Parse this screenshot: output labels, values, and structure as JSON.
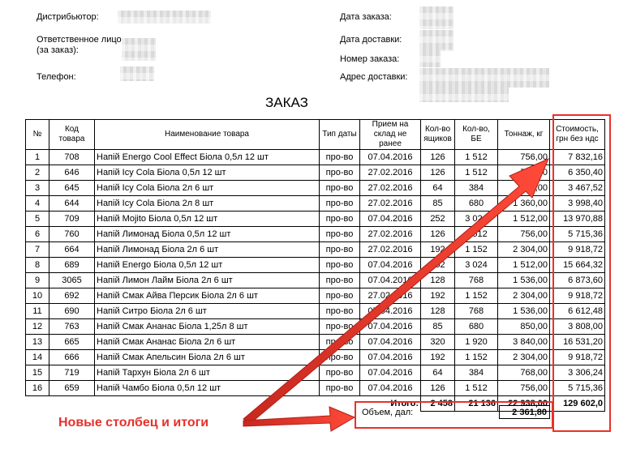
{
  "header": {
    "distributor_label": "Дистрибьютор:",
    "responsible_label": "Ответственное лицо\n(за заказ):",
    "phone_label": "Телефон:",
    "order_date_label": "Дата заказа:",
    "delivery_date_label": "Дата доставки:",
    "order_number_label": "Номер заказа:",
    "delivery_address_label": "Адрес доставки:"
  },
  "title": "ЗАКАЗ",
  "table": {
    "columns": [
      "№",
      "Код товара",
      "Наименование товара",
      "Тип даты",
      "Прием на склад не ранее",
      "Кол-во ящиков",
      "Кол-во, БЕ",
      "Тоннаж, кг",
      "Стоимость, грн без ндс"
    ],
    "rows": [
      [
        "1",
        "708",
        "Напій Energo Cool Effect Біола 0,5л 12 шт",
        "про-во",
        "07.04.2016",
        "126",
        "1 512",
        "756,00",
        "7 832,16"
      ],
      [
        "2",
        "646",
        "Напій Icy Cola Біола 0,5л 12 шт",
        "про-во",
        "27.02.2016",
        "126",
        "1 512",
        "756,00",
        "6 350,40"
      ],
      [
        "3",
        "645",
        "Напій Icy Cola Біола 2л 6 шт",
        "про-во",
        "27.02.2016",
        "64",
        "384",
        "768,00",
        "3 467,52"
      ],
      [
        "4",
        "644",
        "Напій Icy Cola Біола 2л 8 шт",
        "про-во",
        "27.02.2016",
        "85",
        "680",
        "1 360,00",
        "3 998,40"
      ],
      [
        "5",
        "709",
        "Напій Mojito Біола 0,5л 12 шт",
        "про-во",
        "07.04.2016",
        "252",
        "3 024",
        "1 512,00",
        "13 970,88"
      ],
      [
        "6",
        "760",
        "Напій Лимонад Біола 0,5л 12 шт",
        "про-во",
        "27.02.2016",
        "126",
        "1 512",
        "756,00",
        "5 715,36"
      ],
      [
        "7",
        "664",
        "Напій Лимонад Біола 2л 6 шт",
        "про-во",
        "27.02.2016",
        "192",
        "1 152",
        "2 304,00",
        "9 918,72"
      ],
      [
        "8",
        "689",
        "Напій Energo Біола 0,5л 12 шт",
        "про-во",
        "07.04.2016",
        "252",
        "3 024",
        "1 512,00",
        "15 664,32"
      ],
      [
        "9",
        "3065",
        "Напій Лимон Лайм Біола 2л 6 шт",
        "про-во",
        "07.04.2016",
        "128",
        "768",
        "1 536,00",
        "6 873,60"
      ],
      [
        "10",
        "692",
        "Напій Смак Айва Персик Біола 2л 6 шт",
        "про-во",
        "27.02.2016",
        "192",
        "1 152",
        "2 304,00",
        "9 918,72"
      ],
      [
        "11",
        "690",
        "Напій Ситро Біола 2л 6 шт",
        "про-во",
        "07.04.2016",
        "128",
        "768",
        "1 536,00",
        "6 612,48"
      ],
      [
        "12",
        "763",
        "Напій Смак Ананас Біола 1,25л 8 шт",
        "про-во",
        "07.04.2016",
        "85",
        "680",
        "850,00",
        "3 808,00"
      ],
      [
        "13",
        "665",
        "Напій Смак Ананас Біола 2л 6 шт",
        "про-во",
        "07.04.2016",
        "320",
        "1 920",
        "3 840,00",
        "16 531,20"
      ],
      [
        "14",
        "666",
        "Напій Смак Апельсин Біола 2л 6 шт",
        "про-во",
        "07.04.2016",
        "192",
        "1 152",
        "2 304,00",
        "9 918,72"
      ],
      [
        "15",
        "719",
        "Напій Тархун Біола 2л 6 шт",
        "про-во",
        "07.04.2016",
        "64",
        "384",
        "768,00",
        "3 306,24"
      ],
      [
        "16",
        "659",
        "Напій Чамбо Біола 0,5л 12 шт",
        "про-во",
        "07.04.2016",
        "126",
        "1 512",
        "756,00",
        "5 715,36"
      ]
    ],
    "totals": {
      "label": "Итого:",
      "boxes": "2 458",
      "units": "21 136",
      "tonnage": "22 938,00",
      "cost": "129 602,0"
    }
  },
  "volume": {
    "label": "Объем, дал:",
    "value": "2 361,80"
  },
  "annotation": {
    "text": "Новые столбец и итоги",
    "color": "#e8312a"
  }
}
